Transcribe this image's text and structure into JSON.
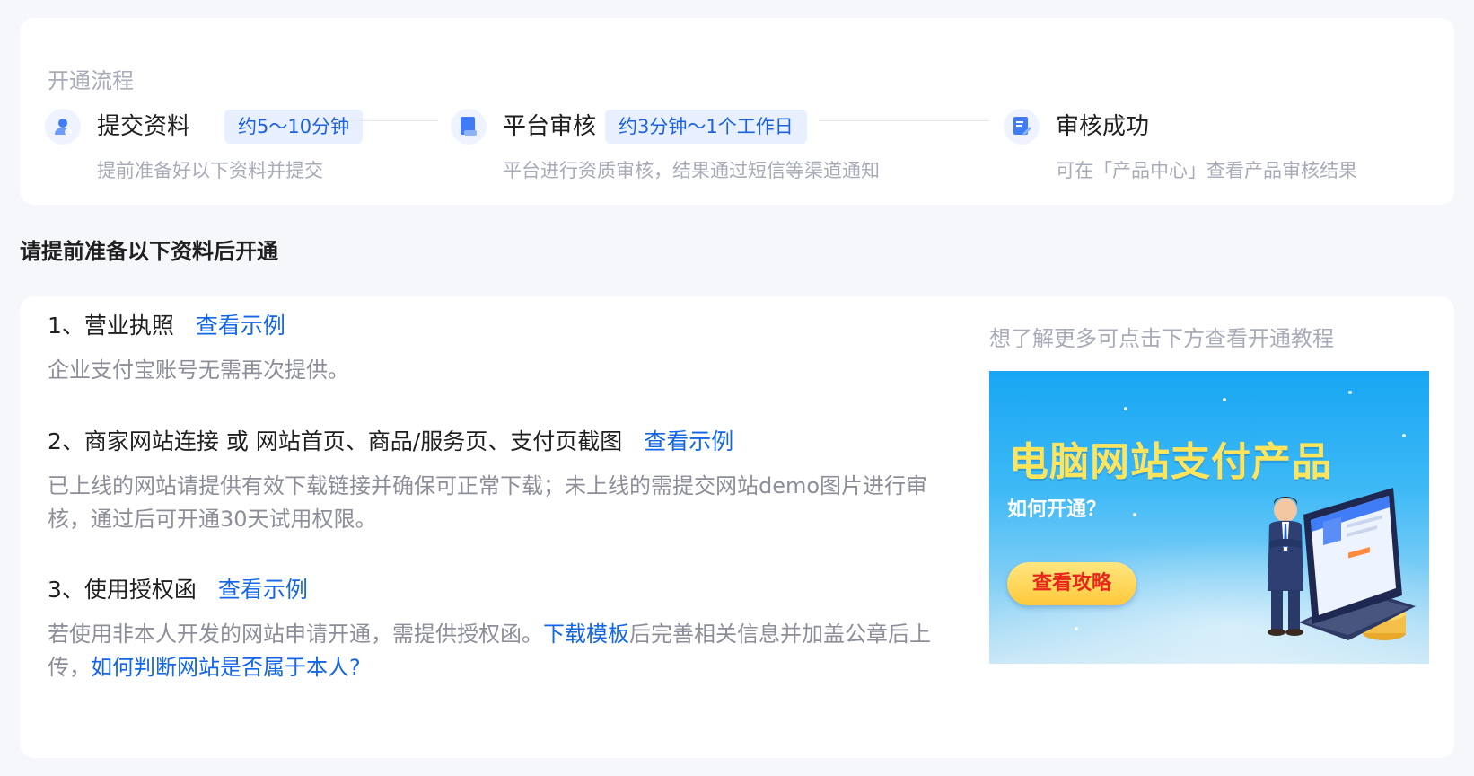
{
  "process": {
    "title": "开通流程",
    "steps": [
      {
        "name": "提交资料",
        "badge": "约5～10分钟",
        "desc": "提前准备好以下资料并提交",
        "icon": "user-icon"
      },
      {
        "name": "平台审核",
        "badge": "约3分钟～1个工作日",
        "desc": "平台进行资质审核，结果通过短信等渠道通知",
        "icon": "document-icon"
      },
      {
        "name": "审核成功",
        "badge": "",
        "desc": "可在「产品中心」查看产品审核结果",
        "icon": "document-check-icon"
      }
    ]
  },
  "materials": {
    "heading": "请提前准备以下资料后开通",
    "items": [
      {
        "title": "1、营业执照",
        "link": "查看示例",
        "desc": "企业支付宝账号无需再次提供。"
      },
      {
        "title": "2、商家网站连接 或 网站首页、商品/服务页、支付页截图",
        "link": "查看示例",
        "desc": "已上线的网站请提供有效下载链接并确保可正常下载；未上线的需提交网站demo图片进行审核，通过后可开通30天试用权限。"
      },
      {
        "title": "3、使用授权函",
        "link": "查看示例",
        "desc_before": "若使用非本人开发的网站申请开通，需提供授权函。",
        "desc_link1": "下载模板",
        "desc_middle": "后完善相关信息并加盖公章后上传，",
        "desc_link2": "如何判断网站是否属于本人?"
      }
    ]
  },
  "tutorial": {
    "hint": "想了解更多可点击下方查看开通教程",
    "banner": {
      "title": "电脑网站支付产品",
      "subtitle": "如何开通？",
      "button": "查看攻略"
    }
  },
  "colors": {
    "accent": "#1366e6",
    "muted": "#a8abb8",
    "badge_bg": "#e8f0ff",
    "banner_title": "#ffe45c",
    "banner_button_text": "#e8261c"
  }
}
